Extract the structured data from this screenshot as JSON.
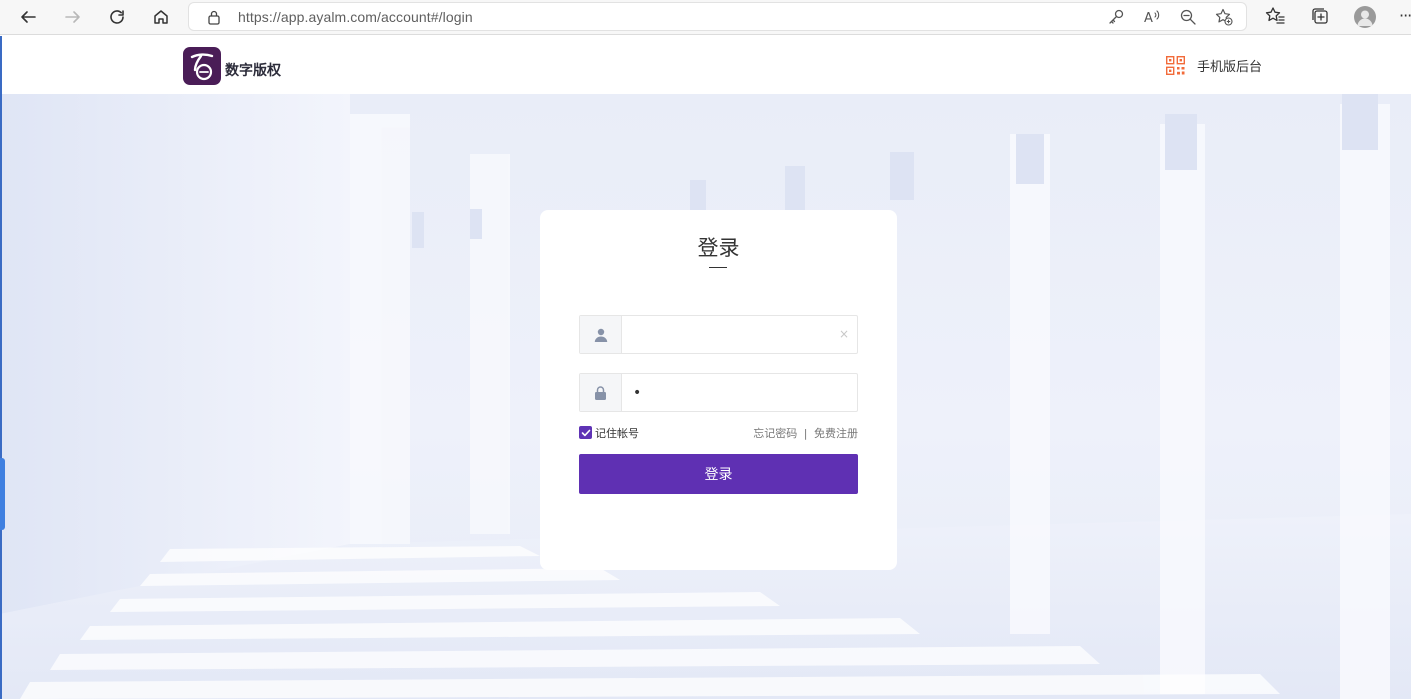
{
  "browser": {
    "url": "https://app.ayalm.com/account#/login",
    "icons": [
      "back-arrow-icon",
      "forward-arrow-icon",
      "refresh-icon",
      "home-icon",
      "lock-icon",
      "key-icon",
      "read-aloud-icon",
      "zoom-out-icon",
      "add-favorite-icon",
      "favorites-icon",
      "collections-icon",
      "profile-icon",
      "more-icon"
    ],
    "more_label": "···"
  },
  "header": {
    "logo_text": "数字版权",
    "mobile_link": "手机版后台",
    "qr_icon": "qr-code-icon",
    "accent_color": "#f26b3a"
  },
  "login": {
    "title": "登录",
    "username": {
      "value": "",
      "placeholder": "",
      "icon": "user-icon",
      "clear_label": "×"
    },
    "password": {
      "value": "•",
      "placeholder": "",
      "icon": "lock-icon"
    },
    "remember_label": "记住帐号",
    "remember_checked": true,
    "forgot_label": "忘记密码",
    "separator": "|",
    "register_label": "免费注册",
    "submit_label": "登录",
    "button_color": "#5f30b3"
  }
}
